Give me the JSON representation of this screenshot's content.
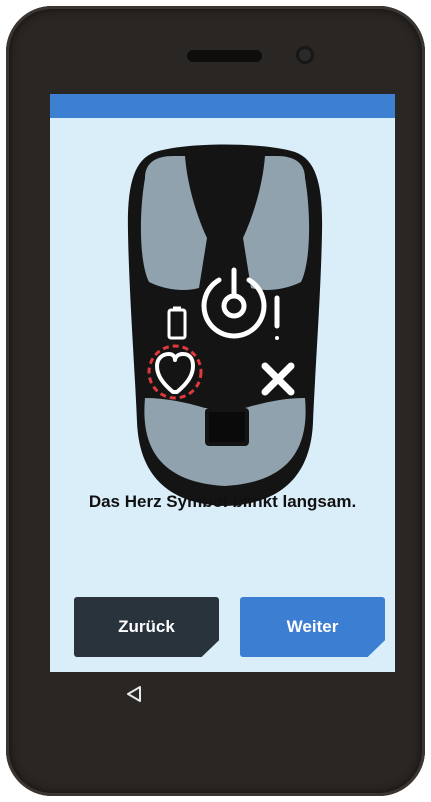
{
  "screen": {
    "message": "Das Herz Symbol blinkt langsam.",
    "colors": {
      "status_bar": "#3d7fd1",
      "background": "#d9eef9",
      "highlight": "#e0393b"
    }
  },
  "device_illustration": {
    "icons": [
      "battery-icon",
      "power-icon",
      "warning-icon",
      "heart-icon",
      "close-icon"
    ],
    "highlighted_icon": "heart-icon"
  },
  "buttons": {
    "back_label": "Zurück",
    "next_label": "Weiter"
  },
  "navigation": {
    "icons": [
      "back-triangle-icon"
    ]
  }
}
